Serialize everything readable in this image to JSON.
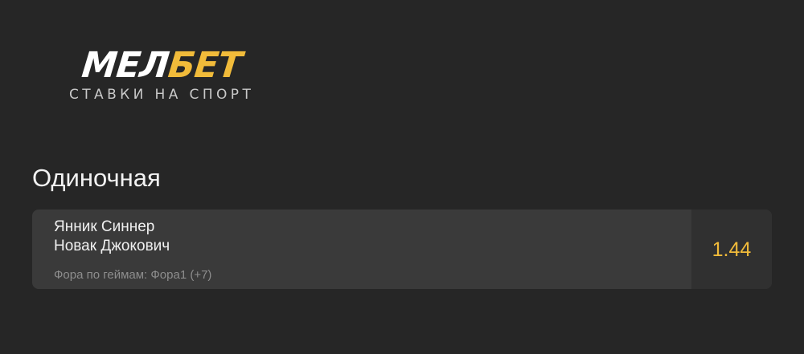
{
  "logo": {
    "brand_part_a": "МЕЛ",
    "brand_part_b": "БЕТ",
    "tagline": "СТАВКИ НА СПОРТ",
    "colors": {
      "primary": "#ffffff",
      "accent": "#f1bb3a"
    }
  },
  "bet_slip": {
    "type_label": "Одиночная",
    "bet": {
      "player_1": "Янник Синнер",
      "player_2": "Новак Джокович",
      "market": "Фора по геймам: Фора1 (+7)",
      "odds": "1.44"
    }
  },
  "colors": {
    "background": "#262626",
    "card": "#3a3a3a",
    "odds_cell": "#303030",
    "odds_text": "#f1bb3a",
    "secondary_text": "#8d8d8d"
  }
}
